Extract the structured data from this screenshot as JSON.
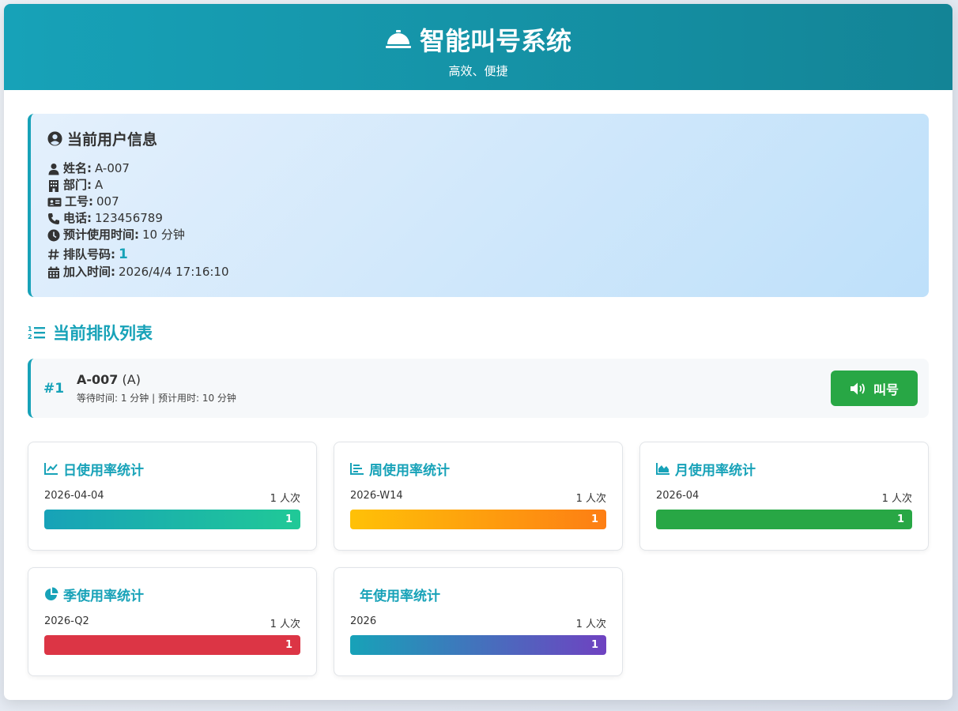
{
  "header": {
    "title": "智能叫号系统",
    "subtitle": "高效、便捷"
  },
  "user": {
    "heading": "当前用户信息",
    "fields": [
      {
        "icon": "user-icon",
        "label": "姓名:",
        "value": "A-007"
      },
      {
        "icon": "building-icon",
        "label": "部门:",
        "value": "A"
      },
      {
        "icon": "id-card-icon",
        "label": "工号:",
        "value": "007"
      },
      {
        "icon": "phone-icon",
        "label": "电话:",
        "value": "123456789"
      },
      {
        "icon": "clock-icon",
        "label": "预计使用时间:",
        "value": "10 分钟"
      }
    ],
    "queue_label": "排队号码:",
    "queue_number": "1",
    "join_label": "加入时间:",
    "join_time": "2026/4/4 17:16:10"
  },
  "queue": {
    "title": "当前排队列表",
    "items": [
      {
        "position": "#1",
        "name": "A-007",
        "dept": "(A)",
        "meta": "等待时间: 1 分钟 | 预计用时: 10 分钟",
        "button": "叫号"
      }
    ]
  },
  "stats": [
    {
      "title": "日使用率统计",
      "period": "2026-04-04",
      "count": "1 人次",
      "value": "1",
      "level": 1.0,
      "colors": [
        "#17a2b8",
        "#20c997"
      ]
    },
    {
      "title": "周使用率统计",
      "period": "2026-W14",
      "count": "1 人次",
      "value": "1",
      "level": 1.0,
      "colors": [
        "#ffc107",
        "#fd7e14"
      ]
    },
    {
      "title": "月使用率统计",
      "period": "2026-04",
      "count": "1 人次",
      "value": "1",
      "level": 1.0,
      "colors": [
        "#28a745"
      ]
    },
    {
      "title": "季使用率统计",
      "period": "2026-Q2",
      "count": "1 人次",
      "value": "1",
      "level": 1.0,
      "colors": [
        "#dc3545"
      ]
    },
    {
      "title": "年使用率统计",
      "period": "2026",
      "count": "1 人次",
      "value": "1",
      "level": 1.0,
      "colors": [
        "#17a2b8",
        "#6f42c1"
      ]
    }
  ]
}
